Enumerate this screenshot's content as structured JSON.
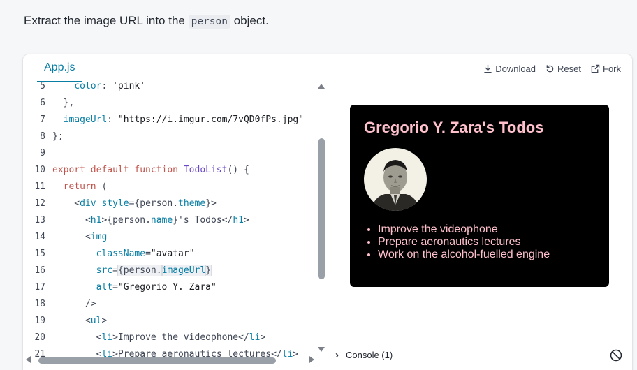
{
  "instructions": {
    "before": "Extract the image URL into the ",
    "code": "person",
    "after": " object."
  },
  "toolbar": {
    "tab_label": "App.js",
    "download_label": "Download",
    "reset_label": "Reset",
    "fork_label": "Fork"
  },
  "code_lines": [
    {
      "num": "5",
      "tokens": [
        [
          "p",
          "    "
        ],
        [
          "prop",
          "color"
        ],
        [
          "p",
          ": "
        ],
        [
          "str",
          "'pink'"
        ]
      ]
    },
    {
      "num": "6",
      "tokens": [
        [
          "p",
          "  },"
        ]
      ]
    },
    {
      "num": "7",
      "tokens": [
        [
          "p",
          "  "
        ],
        [
          "prop",
          "imageUrl"
        ],
        [
          "p",
          ": "
        ],
        [
          "str",
          "\"https://i.imgur.com/7vQD0fPs.jpg\""
        ]
      ]
    },
    {
      "num": "8",
      "tokens": [
        [
          "p",
          "};"
        ]
      ]
    },
    {
      "num": "9",
      "tokens": []
    },
    {
      "num": "10",
      "tokens": [
        [
          "kw",
          "export default function "
        ],
        [
          "fn",
          "TodoList"
        ],
        [
          "p",
          "() {"
        ]
      ]
    },
    {
      "num": "11",
      "tokens": [
        [
          "p",
          "  "
        ],
        [
          "kw",
          "return"
        ],
        [
          "p",
          " ("
        ]
      ]
    },
    {
      "num": "12",
      "tokens": [
        [
          "p",
          "    <"
        ],
        [
          "tag",
          "div"
        ],
        [
          "p",
          " "
        ],
        [
          "attr",
          "style"
        ],
        [
          "p",
          "={person."
        ],
        [
          "prop",
          "theme"
        ],
        [
          "p",
          "}>"
        ]
      ]
    },
    {
      "num": "13",
      "tokens": [
        [
          "p",
          "      <"
        ],
        [
          "tag",
          "h1"
        ],
        [
          "p",
          ">{person."
        ],
        [
          "prop",
          "name"
        ],
        [
          "p",
          "}'s Todos</"
        ],
        [
          "tag",
          "h1"
        ],
        [
          "p",
          ">"
        ]
      ]
    },
    {
      "num": "14",
      "tokens": [
        [
          "p",
          "      <"
        ],
        [
          "tag",
          "img"
        ]
      ]
    },
    {
      "num": "15",
      "tokens": [
        [
          "p",
          "        "
        ],
        [
          "attr",
          "className"
        ],
        [
          "p",
          "="
        ],
        [
          "str",
          "\"avatar\""
        ]
      ]
    },
    {
      "num": "16",
      "tokens": [
        [
          "p",
          "        "
        ],
        [
          "attr",
          "src"
        ],
        [
          "p",
          "="
        ],
        [
          "hl",
          "{person."
        ],
        [
          "hlprop",
          "imageUrl"
        ],
        [
          "hl",
          "}"
        ]
      ]
    },
    {
      "num": "17",
      "tokens": [
        [
          "p",
          "        "
        ],
        [
          "attr",
          "alt"
        ],
        [
          "p",
          "="
        ],
        [
          "str",
          "\"Gregorio Y. Zara\""
        ]
      ]
    },
    {
      "num": "18",
      "tokens": [
        [
          "p",
          "      />"
        ]
      ]
    },
    {
      "num": "19",
      "tokens": [
        [
          "p",
          "      <"
        ],
        [
          "tag",
          "ul"
        ],
        [
          "p",
          ">"
        ]
      ]
    },
    {
      "num": "20",
      "tokens": [
        [
          "p",
          "        <"
        ],
        [
          "tag",
          "li"
        ],
        [
          "p",
          ">Improve the videophone</"
        ],
        [
          "tag",
          "li"
        ],
        [
          "p",
          ">"
        ]
      ]
    },
    {
      "num": "21",
      "tokens": [
        [
          "p",
          "        <"
        ],
        [
          "tag",
          "li"
        ],
        [
          "p",
          ">Prepare aeronautics lectures</"
        ],
        [
          "tag",
          "li"
        ],
        [
          "p",
          ">"
        ]
      ]
    }
  ],
  "preview": {
    "heading": "Gregorio Y. Zara's Todos",
    "avatar_alt": "Gregorio Y. Zara",
    "todos": [
      "Improve the videophone",
      "Prepare aeronautics lectures",
      "Work on the alcohol-fuelled engine"
    ]
  },
  "console": {
    "label": "Console (1)"
  },
  "colors": {
    "accent": "#087ea4",
    "card_bg": "#000000",
    "card_text": "#ffc0cb"
  }
}
